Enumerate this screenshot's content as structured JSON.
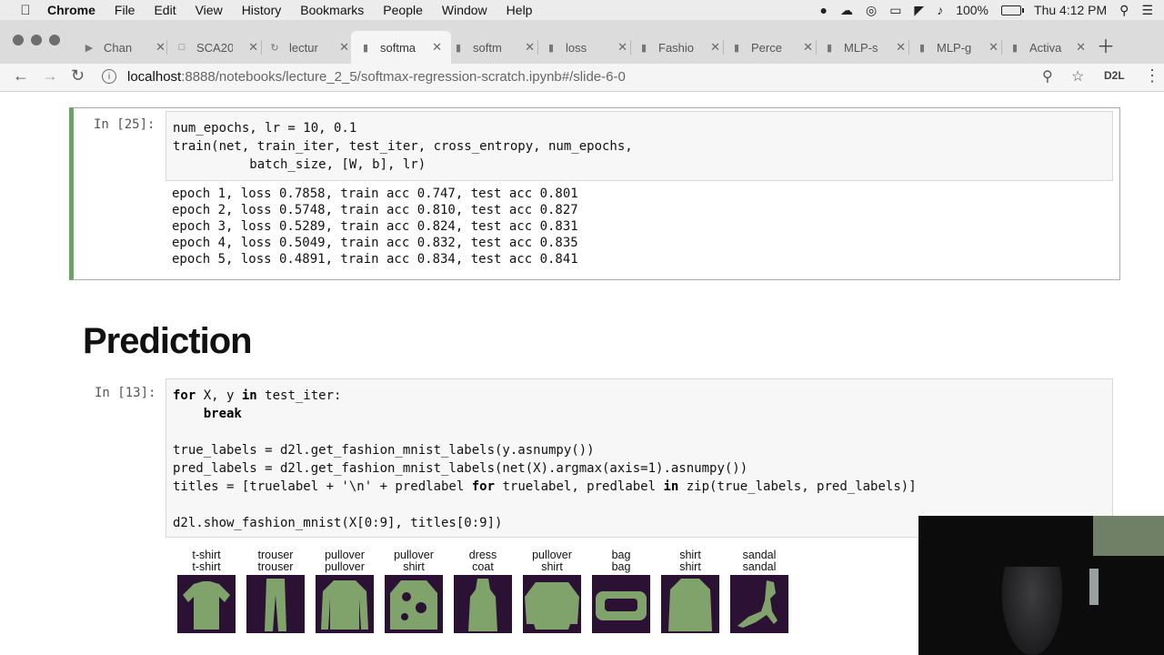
{
  "menubar": {
    "app": "Chrome",
    "items": [
      "File",
      "Edit",
      "View",
      "History",
      "Bookmarks",
      "People",
      "Window",
      "Help"
    ],
    "battery": "100%",
    "clock": "Thu 4:12 PM"
  },
  "tabs": [
    {
      "label": "Chan",
      "icon": "youtube-icon"
    },
    {
      "label": "SCA20",
      "icon": "document-icon"
    },
    {
      "label": "lectur",
      "icon": "loading-icon"
    },
    {
      "label": "softma",
      "icon": "file-icon",
      "active": true
    },
    {
      "label": "softm",
      "icon": "file-icon"
    },
    {
      "label": "loss",
      "icon": "file-icon"
    },
    {
      "label": "Fashio",
      "icon": "file-icon"
    },
    {
      "label": "Perce",
      "icon": "file-icon"
    },
    {
      "label": "MLP-s",
      "icon": "file-icon"
    },
    {
      "label": "MLP-g",
      "icon": "file-icon"
    },
    {
      "label": "Activa",
      "icon": "file-icon"
    }
  ],
  "toolbar": {
    "url_host": "localhost",
    "url_path": ":8888/notebooks/lecture_2_5/softmax-regression-scratch.ipynb#/slide-6-0",
    "extension": "D2L"
  },
  "cell1": {
    "prompt": "In [25]:",
    "code": [
      "num_epochs, lr = 10, 0.1",
      "train(net, train_iter, test_iter, cross_entropy, num_epochs,",
      "          batch_size, [W, b], lr)"
    ],
    "output": [
      "epoch 1, loss 0.7858, train acc 0.747, test acc 0.801",
      "epoch 2, loss 0.5748, train acc 0.810, test acc 0.827",
      "epoch 3, loss 0.5289, train acc 0.824, test acc 0.831",
      "epoch 4, loss 0.5049, train acc 0.832, test acc 0.835",
      "epoch 5, loss 0.4891, train acc 0.834, test acc 0.841"
    ]
  },
  "section_heading": "Prediction",
  "cell2": {
    "prompt": "In [13]:",
    "line1": {
      "kw1": "for",
      "mid": " X, y ",
      "kw2": "in",
      "rest": " test_iter:"
    },
    "line2": {
      "indent": "    ",
      "kw": "break"
    },
    "line3": "true_labels = d2l.get_fashion_mnist_labels(y.asnumpy())",
    "line4": "pred_labels = d2l.get_fashion_mnist_labels(net(X).argmax(axis=1).asnumpy())",
    "line5": {
      "a": "titles = [truelabel + '\\n' + predlabel ",
      "kw1": "for",
      "b": " truelabel, predlabel ",
      "kw2": "in",
      "c": " zip(true_labels, pred_labels)]"
    },
    "line6": "d2l.show_fashion_mnist(X[0:9], titles[0:9])"
  },
  "predictions": [
    {
      "true": "t-shirt",
      "pred": "t-shirt",
      "image": "tshirt"
    },
    {
      "true": "trouser",
      "pred": "trouser",
      "image": "trouser"
    },
    {
      "true": "pullover",
      "pred": "pullover",
      "image": "pullover"
    },
    {
      "true": "pullover",
      "pred": "shirt",
      "image": "pullover"
    },
    {
      "true": "dress",
      "pred": "coat",
      "image": "dress"
    },
    {
      "true": "pullover",
      "pred": "shirt",
      "image": "pullover"
    },
    {
      "true": "bag",
      "pred": "bag",
      "image": "bag"
    },
    {
      "true": "shirt",
      "pred": "shirt",
      "image": "shirt"
    },
    {
      "true": "sandal",
      "pred": "sandal",
      "image": "sandal"
    }
  ],
  "colors": {
    "selected_cell_border": "#66a566",
    "image_background": "#2b1134",
    "image_foreground": "#7fa36b"
  }
}
